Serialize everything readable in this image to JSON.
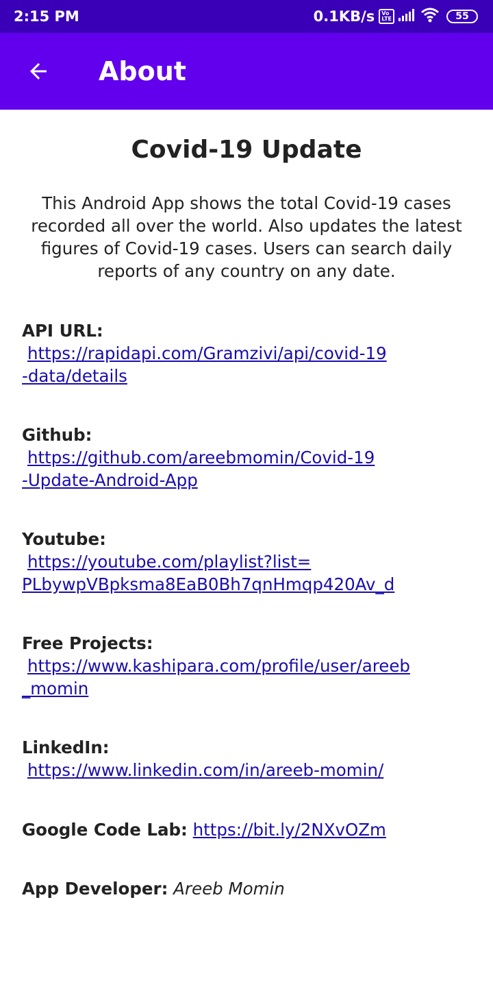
{
  "status_bar": {
    "time": "2:15 PM",
    "network_speed": "0.1KB/s",
    "volte": "VoLTE",
    "battery": "55",
    "icons": [
      "volte-icon",
      "signal-icon",
      "wifi-icon",
      "battery-icon"
    ]
  },
  "app_bar": {
    "title": "About",
    "back_icon": "arrow-back-icon",
    "color": "#6200ee"
  },
  "headline": "Covid-19 Update",
  "description": "This Android App shows the total Covid-19 cases recorded all over the world. Also updates the latest figures of Covid-19 cases. Users can search daily reports of any country on any date.",
  "links": {
    "api": {
      "label": "API URL:",
      "url_line1": "https://rapidapi.com/Gramzivi/api/covid-19",
      "url_line2": "-data/details"
    },
    "github": {
      "label": "Github:",
      "url_line1": "https://github.com/areebmomin/Covid-19",
      "url_line2": "-Update-Android-App"
    },
    "youtube": {
      "label": "Youtube:",
      "url_line1": "https://youtube.com/playlist?list=",
      "url_line2": "PLbywpVBpksma8EaB0Bh7qnHmqp420Av_d"
    },
    "free_projects": {
      "label": "Free Projects:",
      "url_line1": "https://www.kashipara.com/profile/user/areeb",
      "url_line2": "_momin"
    },
    "linkedin": {
      "label": "LinkedIn:",
      "url_line1": "https://www.linkedin.com/in/areeb-momin/"
    },
    "codelab": {
      "label": "Google Code Lab:",
      "url": "https://bit.ly/2NXvOZm"
    }
  },
  "developer": {
    "label": "App Developer:",
    "name": "Areeb Momin"
  },
  "colors": {
    "status_bar": "#3a00b8",
    "app_bar": "#6200ee",
    "link": "#1a0dab"
  }
}
